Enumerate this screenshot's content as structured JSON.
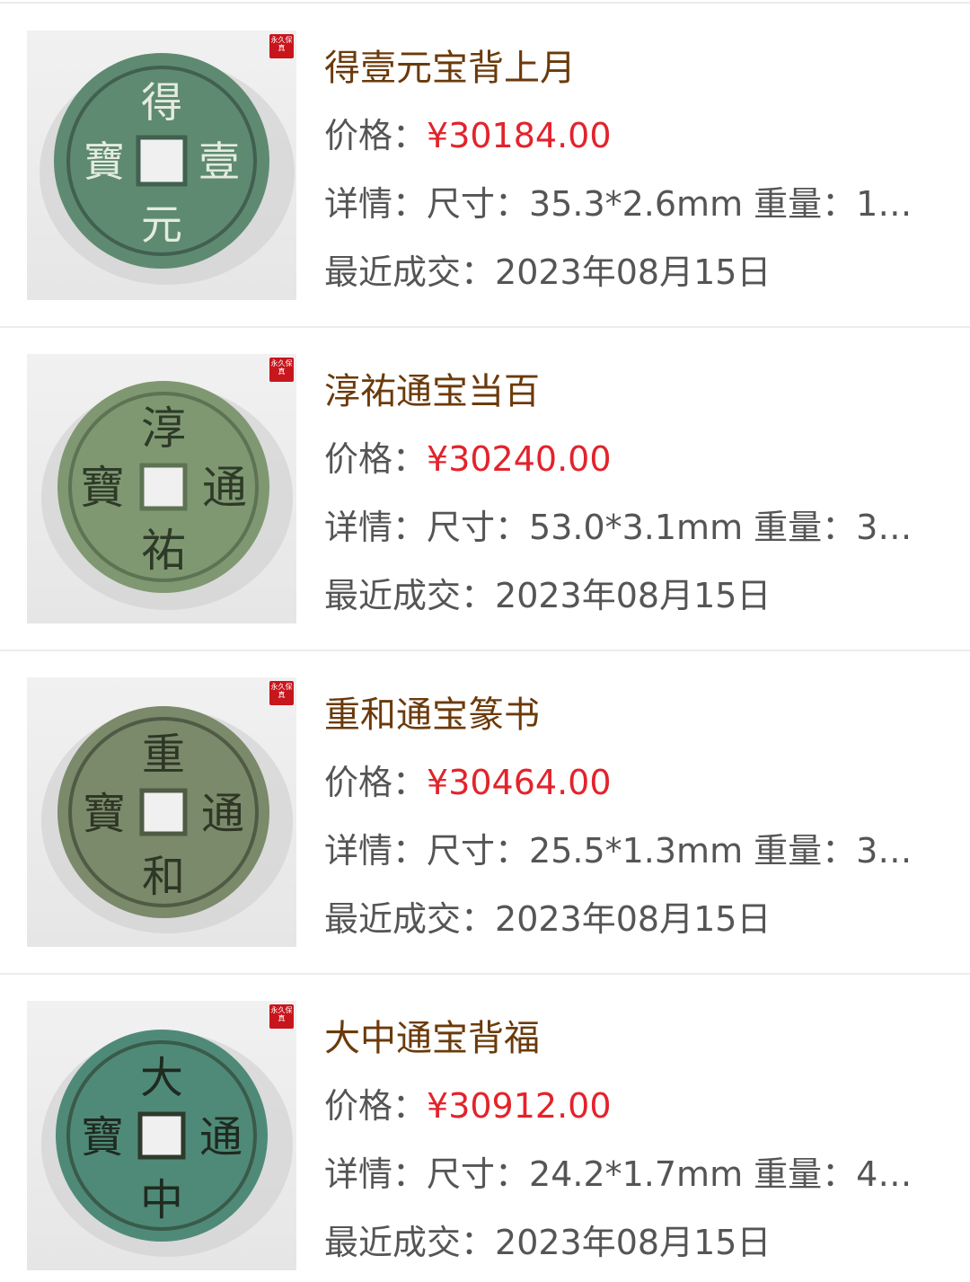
{
  "labels": {
    "price": "价格：",
    "detail": "详情：",
    "recent": "最近成交："
  },
  "colors": {
    "title": "#6b3a0a",
    "price": "#e3232c",
    "text": "#555555",
    "seal": "#c8161d"
  },
  "seal_text": "永久保真",
  "items": [
    {
      "title": "得壹元宝背上月",
      "price": "¥30184.00",
      "detail": "尺寸：35.3*2.6mm 重量：1…",
      "date": "2023年08月15日",
      "coin_chars": [
        "得",
        "壹",
        "元",
        "寶"
      ],
      "coin_color": "#5f8a72"
    },
    {
      "title": "淳祐通宝当百",
      "price": "¥30240.00",
      "detail": "尺寸：53.0*3.1mm 重量：3…",
      "date": "2023年08月15日",
      "coin_chars": [
        "淳",
        "通",
        "祐",
        "寶"
      ],
      "coin_color": "#7f9872"
    },
    {
      "title": "重和通宝篆书",
      "price": "¥30464.00",
      "detail": "尺寸：25.5*1.3mm 重量：3…",
      "date": "2023年08月15日",
      "coin_chars": [
        "重",
        "通",
        "和",
        "寶"
      ],
      "coin_color": "#7a8a6a"
    },
    {
      "title": "大中通宝背福",
      "price": "¥30912.00",
      "detail": "尺寸：24.2*1.7mm 重量：4…",
      "date": "2023年08月15日",
      "coin_chars": [
        "大",
        "通",
        "中",
        "寶"
      ],
      "coin_color": "#4f8a78"
    }
  ]
}
